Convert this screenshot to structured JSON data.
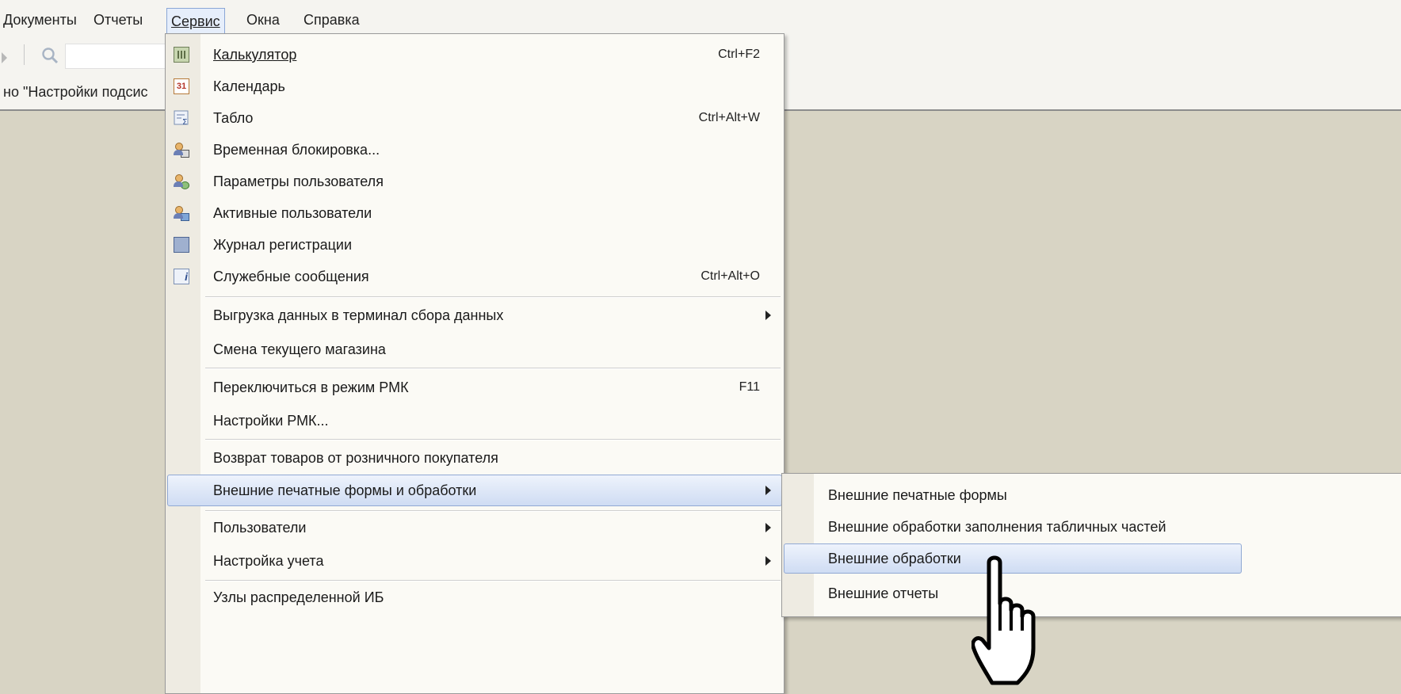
{
  "menubar": {
    "items": [
      "Документы",
      "Отчеты",
      "Сервис",
      "Окна",
      "Справка"
    ]
  },
  "status_text": "но \"Настройки подсис",
  "menu": {
    "items": [
      {
        "label": "Калькулятор",
        "shortcut": "Ctrl+F2",
        "icon": "calculator-icon"
      },
      {
        "label": "Календарь",
        "shortcut": "",
        "icon": "calendar-icon",
        "icon_text": "31"
      },
      {
        "label": "Табло",
        "shortcut": "Ctrl+Alt+W",
        "icon": "tablo-icon"
      },
      {
        "label": "Временная блокировка...",
        "shortcut": "",
        "icon": "user-lock-icon"
      },
      {
        "label": "Параметры пользователя",
        "shortcut": "",
        "icon": "user-settings-icon"
      },
      {
        "label": "Активные пользователи",
        "shortcut": "",
        "icon": "active-users-icon"
      },
      {
        "label": "Журнал регистрации",
        "shortcut": "",
        "icon": "log-icon"
      },
      {
        "label": "Служебные сообщения",
        "shortcut": "Ctrl+Alt+O",
        "icon": "info-messages-icon"
      },
      {
        "label": "Выгрузка данных в терминал сбора данных",
        "submenu": true
      },
      {
        "label": "Смена текущего магазина"
      },
      {
        "label": "Переключиться в режим РМК",
        "shortcut": "F11"
      },
      {
        "label": "Настройки РМК..."
      },
      {
        "label": "Возврат товаров от розничного покупателя"
      },
      {
        "label": "Внешние печатные формы и обработки",
        "submenu": true,
        "highlighted": true
      },
      {
        "label": "Пользователи",
        "submenu": true
      },
      {
        "label": "Настройка учета",
        "submenu": true
      },
      {
        "label": "Узлы распределенной ИБ"
      }
    ]
  },
  "submenu": {
    "items": [
      {
        "label": "Внешние печатные формы"
      },
      {
        "label": "Внешние обработки заполнения табличных частей"
      },
      {
        "label": "Внешние обработки",
        "highlighted": true
      },
      {
        "label": "Внешние отчеты"
      }
    ]
  }
}
